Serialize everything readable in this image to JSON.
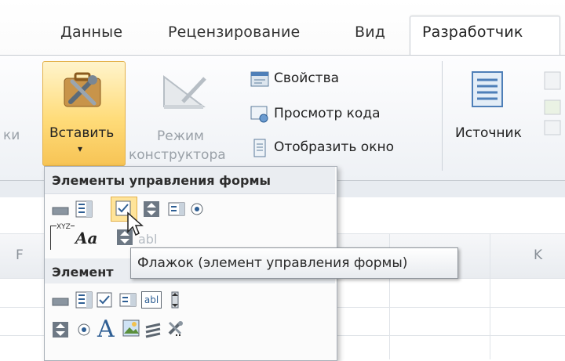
{
  "tabs": {
    "data": "Данные",
    "review": "Рецензирование",
    "view": "Вид",
    "developer": "Разработчик"
  },
  "ribbon": {
    "insert_label": "Вставить",
    "insert_arrow": "▾",
    "design_mode_line1": "Режим",
    "design_mode_line2": "конструктора",
    "properties": "Свойства",
    "view_code": "Просмотр кода",
    "show_window": "Отобразить окно",
    "source": "Источник",
    "left_partial": "ки"
  },
  "sheet": {
    "col_f": "F",
    "col_k": "K"
  },
  "panel": {
    "form_controls_title": "Элементы управления формы",
    "activex_title_partial": "Элемент"
  },
  "tooltip": {
    "text": "Флажок (элемент управления формы)"
  },
  "icons": {
    "textbox_label": "abl",
    "label_a": "A",
    "label_aa": "Aa",
    "xyz": "XYZ"
  },
  "colors": {
    "insert_highlight": "#ffdc7a",
    "ribbon_bg": "#eef1f5",
    "panel_header": "#eaedf1"
  }
}
